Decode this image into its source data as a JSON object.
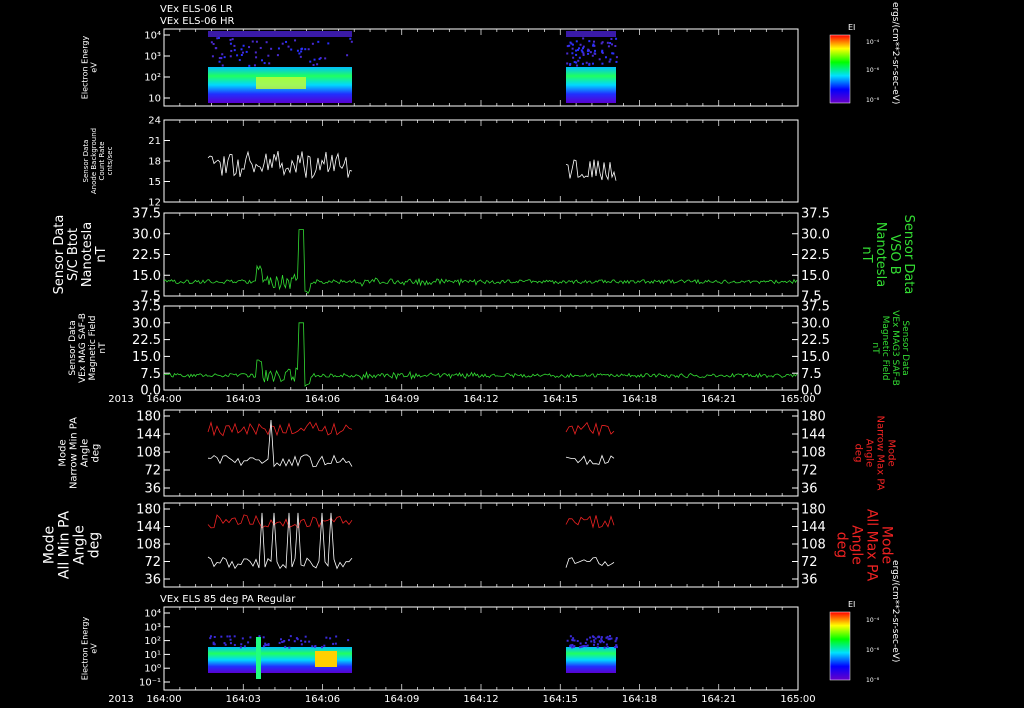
{
  "colors": {
    "background": "#000000",
    "frame": "#ffffff",
    "green": "#33dd33",
    "red": "#ee2222",
    "white": "#ffffff"
  },
  "header": {
    "line1": "VEx ELS-06 LR",
    "line2": "VEx ELS-06 HR"
  },
  "panel7_title": "VEx ELS 85 deg PA Regular",
  "time_axis": {
    "year": "2013",
    "ticks": [
      "164:00",
      "164:03",
      "164:06",
      "164:09",
      "164:12",
      "164:15",
      "164:18",
      "164:21",
      "165:00"
    ]
  },
  "colorbar": {
    "label": "EI",
    "unit": "ergs/(cm**2-sr-sec-eV)",
    "ticks": [
      "10⁻⁴",
      "10⁻⁶",
      "10⁻⁸"
    ]
  },
  "chart_data": [
    {
      "type": "heatmap",
      "ylabel": [
        "Electron Energy",
        "eV"
      ],
      "yticks": [
        "10⁴",
        "10³",
        "10²",
        "10"
      ],
      "scale": "log"
    },
    {
      "type": "line",
      "ylabel": [
        "Sensor Data",
        "Anode Background",
        "Count Rate",
        "cnts/sec"
      ],
      "yticks": [
        "24",
        "21",
        "18",
        "15",
        "12"
      ],
      "ylim": [
        9,
        24
      ]
    },
    {
      "type": "line",
      "ylabel": [
        "Sensor Data",
        "S/C Btot",
        "Nanotesla",
        "nT"
      ],
      "ylabel_right": [
        "Sensor Data",
        "VSO B",
        "Nanotesla",
        "nT"
      ],
      "yticks": [
        "37.5",
        "30.0",
        "22.5",
        "15.0",
        "7.5"
      ],
      "ylim": [
        0,
        37.5
      ]
    },
    {
      "type": "line",
      "ylabel": [
        "Sensor Data",
        "VEx MAG SAF-B",
        "Magnetic Field",
        "nT"
      ],
      "ylabel_right": [
        "Sensor Data",
        "VEx MAG3 SAF-B",
        "Magnetic Field",
        "nT"
      ],
      "yticks": [
        "37.5",
        "30.0",
        "22.5",
        "15.0",
        "7.5",
        "0.0"
      ],
      "ylim": [
        0,
        37.5
      ]
    },
    {
      "type": "line",
      "ylabel": [
        "Mode",
        "Narrow Min PA",
        "Angle",
        "deg"
      ],
      "ylabel_right": [
        "Mode",
        "Narrow Max PA",
        "Angle",
        "deg"
      ],
      "yticks": [
        "180",
        "144",
        "108",
        "72",
        "36"
      ],
      "ylim": [
        0,
        180
      ]
    },
    {
      "type": "line",
      "ylabel": [
        "Mode",
        "All Min PA",
        "Angle",
        "deg"
      ],
      "ylabel_right": [
        "Mode",
        "All Max PA",
        "Angle",
        "deg"
      ],
      "yticks": [
        "180",
        "144",
        "108",
        "72",
        "36"
      ],
      "ylim": [
        0,
        180
      ]
    },
    {
      "type": "heatmap",
      "ylabel": [
        "Electron Energy",
        "eV"
      ],
      "yticks": [
        "10⁴",
        "10³",
        "10²",
        "10¹",
        "10⁰",
        "10⁻¹"
      ],
      "scale": "log"
    }
  ]
}
